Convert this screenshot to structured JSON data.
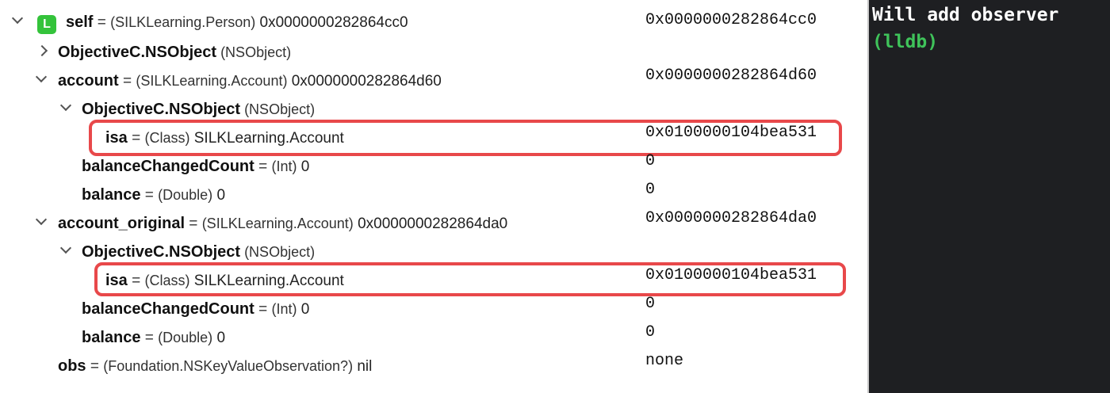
{
  "variables": {
    "self": {
      "badge": "L",
      "name": "self",
      "eq": " = ",
      "type": "(SILKLearning.Person)",
      "value": " 0x0000000282864cc0",
      "summary": "0x0000000282864cc0"
    },
    "self_nsobject": {
      "name": "ObjectiveC.NSObject",
      "type": " (NSObject)"
    },
    "account": {
      "name": "account",
      "eq": " = ",
      "type": "(SILKLearning.Account)",
      "value": " 0x0000000282864d60",
      "summary": "0x0000000282864d60"
    },
    "account_nsobject": {
      "name": "ObjectiveC.NSObject",
      "type": " (NSObject)"
    },
    "account_isa": {
      "name": "isa",
      "eq": " = ",
      "type": "(Class)",
      "value": " SILKLearning.Account",
      "summary": "0x0100000104bea531"
    },
    "account_balanceChangedCount": {
      "name": "balanceChangedCount",
      "eq": " = ",
      "type": "(Int)",
      "value": " 0",
      "summary": "0"
    },
    "account_balance": {
      "name": "balance",
      "eq": " = ",
      "type": "(Double)",
      "value": " 0",
      "summary": "0"
    },
    "account_original": {
      "name": "account_original",
      "eq": " = ",
      "type": "(SILKLearning.Account)",
      "value": " 0x0000000282864da0",
      "summary": "0x0000000282864da0"
    },
    "original_nsobject": {
      "name": "ObjectiveC.NSObject",
      "type": " (NSObject)"
    },
    "original_isa": {
      "name": "isa",
      "eq": " = ",
      "type": "(Class)",
      "value": " SILKLearning.Account",
      "summary": "0x0100000104bea531"
    },
    "original_balanceChangedCount": {
      "name": "balanceChangedCount",
      "eq": " = ",
      "type": "(Int)",
      "value": " 0",
      "summary": "0"
    },
    "original_balance": {
      "name": "balance",
      "eq": " = ",
      "type": "(Double)",
      "value": " 0",
      "summary": "0"
    },
    "obs": {
      "name": "obs",
      "eq": " = ",
      "type": "(Foundation.NSKeyValueObservation?)",
      "value": " nil",
      "summary": "none"
    }
  },
  "console": {
    "output_line": "Will add observer",
    "prompt": "(lldb)"
  },
  "colors": {
    "badge_green": "#34c33b",
    "highlight_red": "#e8484a",
    "console_bg": "#1e1f22",
    "console_text": "#ffffff",
    "prompt_green": "#3fc35a"
  }
}
